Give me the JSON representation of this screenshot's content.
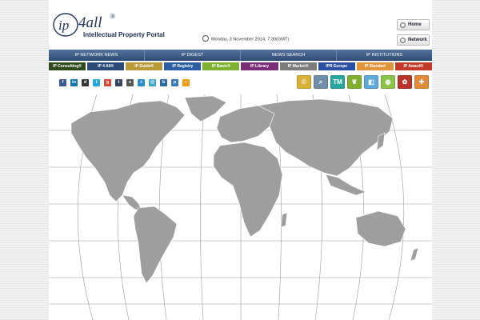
{
  "logo": {
    "brand": "4all",
    "registered": "®",
    "tagline": "Intellectual Property Portal"
  },
  "datetime": "Monday, 3 November 2014, 7:30(GMT)",
  "header_buttons": {
    "home": "Home",
    "network": "Network"
  },
  "top_nav": [
    {
      "label": "IP NETWORK NEWS"
    },
    {
      "label": "IP DIGEST"
    },
    {
      "label": "NEWS SEARCH"
    },
    {
      "label": "IP INSTITUTIONS"
    }
  ],
  "category_nav": [
    {
      "label": "IP Consulting®",
      "color": "#2e4a1c"
    },
    {
      "label": "IP 4 All®",
      "color": "#2a4a78"
    },
    {
      "label": "IP Guide®",
      "color": "#b79a3a"
    },
    {
      "label": "IP Registry",
      "color": "#2b5fa3"
    },
    {
      "label": "IP Basic®",
      "color": "#7fb032"
    },
    {
      "label": "IP Library",
      "color": "#7a2e7a"
    },
    {
      "label": "IP Market®",
      "color": "#7c7c7c"
    },
    {
      "label": "IPR Europe",
      "color": "#2b4fa3"
    },
    {
      "label": "IP Standart",
      "color": "#e0953a"
    },
    {
      "label": "IP Award®",
      "color": "#c23a2a"
    }
  ],
  "social_icons": [
    {
      "name": "facebook-icon",
      "glyph": "f",
      "color": "#3b5998"
    },
    {
      "name": "linkedin-icon",
      "glyph": "in",
      "color": "#0e76a8"
    },
    {
      "name": "delicious-icon",
      "glyph": "d",
      "color": "#333333"
    },
    {
      "name": "twitter-icon",
      "glyph": "t",
      "color": "#29a9e1"
    },
    {
      "name": "google-plus-icon",
      "glyph": "g",
      "color": "#d34836"
    },
    {
      "name": "tumblr-icon",
      "glyph": "t",
      "color": "#35465c"
    },
    {
      "name": "stumbleupon-icon",
      "glyph": "s",
      "color": "#555555"
    },
    {
      "name": "share-icon",
      "glyph": "+",
      "color": "#2a8dd0"
    },
    {
      "name": "email-icon",
      "glyph": "@",
      "color": "#3fa9c9"
    },
    {
      "name": "bookmark-icon",
      "glyph": "b",
      "color": "#2d6aa0"
    },
    {
      "name": "print-icon",
      "glyph": "p",
      "color": "#3a78b8"
    },
    {
      "name": "rss-icon",
      "glyph": "r",
      "color": "#f39c12"
    }
  ],
  "tool_icons": [
    {
      "name": "copyright-icon",
      "glyph": "©",
      "color": "#d9b23a"
    },
    {
      "name": "search-icon",
      "glyph": "⌕",
      "color": "#6f8fa8"
    },
    {
      "name": "trademark-icon",
      "glyph": "TM",
      "color": "#2aa6a0"
    },
    {
      "name": "plant-variety-icon",
      "glyph": "❦",
      "color": "#7fb032"
    },
    {
      "name": "design-icon",
      "glyph": "◧",
      "color": "#5fa9d8"
    },
    {
      "name": "globe-icon",
      "glyph": "◍",
      "color": "#8cc34a"
    },
    {
      "name": "settings-icon",
      "glyph": "✿",
      "color": "#b8342a"
    },
    {
      "name": "patent-icon",
      "glyph": "✚",
      "color": "#e08a3c"
    }
  ]
}
